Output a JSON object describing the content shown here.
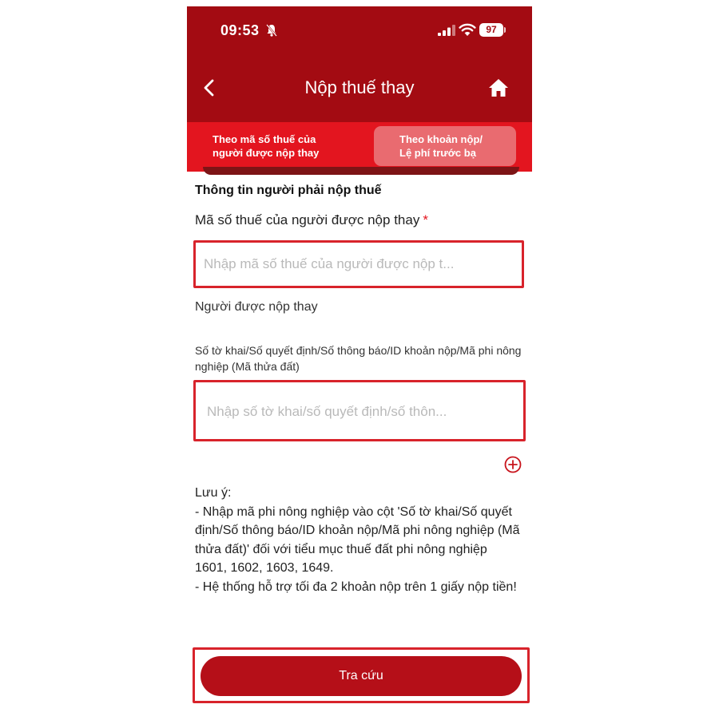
{
  "status_bar": {
    "time": "09:53",
    "battery": "97"
  },
  "header": {
    "title": "Nộp thuế thay"
  },
  "tabs": [
    {
      "label_line1": "Theo mã số thuế của",
      "label_line2": "người được nộp thay",
      "active": false
    },
    {
      "label_line1": "Theo khoản nộp/",
      "label_line2": "Lệ phí trước bạ",
      "active": true
    }
  ],
  "form": {
    "section_title": "Thông tin người phải nộp thuế",
    "taxcode_label": "Mã số thuế của người được nộp thay",
    "required_mark": "*",
    "taxcode_placeholder": "Nhập mã số thuế của người được nộp t...",
    "payer_label": "Người được nộp thay",
    "doc_label": "Số tờ khai/Số quyết định/Số thông báo/ID khoản nộp/Mã phi nông nghiệp (Mã thửa đất)",
    "doc_placeholder": "Nhập số tờ khai/số quyết định/số thôn..."
  },
  "note": {
    "title": "Lưu ý:",
    "line1": " - Nhập mã phi nông nghiệp vào cột 'Số tờ khai/Số quyết định/Số thông báo/ID khoản nộp/Mã phi nông nghiệp (Mã thửa đất)' đối với tiểu mục thuế đất phi nông nghiệp 1601, 1602, 1603, 1649.",
    "line2": " - Hệ thống hỗ trợ tối đa 2 khoản nộp trên 1 giấy nộp tiền!"
  },
  "actions": {
    "search_label": "Tra cứu"
  },
  "colors": {
    "header_bg": "#a30b12",
    "tab_bar_bg": "#e3151f",
    "active_tab_bg": "#e96b70",
    "highlight_border": "#d8232b",
    "primary_button": "#b50f18"
  }
}
